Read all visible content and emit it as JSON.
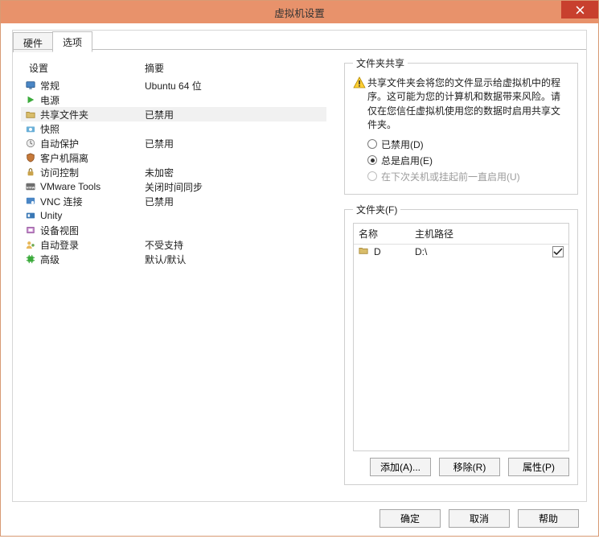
{
  "window": {
    "title": "虚拟机设置"
  },
  "tabs": {
    "hardware": "硬件",
    "options": "选项"
  },
  "left": {
    "header_setting": "设置",
    "header_summary": "摘要",
    "items": [
      {
        "name": "常规",
        "summary": "Ubuntu 64 位",
        "icon": "monitor",
        "sel": false
      },
      {
        "name": "电源",
        "summary": "",
        "icon": "play",
        "sel": false
      },
      {
        "name": "共享文件夹",
        "summary": "已禁用",
        "icon": "folder",
        "sel": true
      },
      {
        "name": "快照",
        "summary": "",
        "icon": "camera",
        "sel": false
      },
      {
        "name": "自动保护",
        "summary": "已禁用",
        "icon": "clock",
        "sel": false
      },
      {
        "name": "客户机隔离",
        "summary": "",
        "icon": "shield",
        "sel": false
      },
      {
        "name": "访问控制",
        "summary": "未加密",
        "icon": "lock",
        "sel": false
      },
      {
        "name": "VMware Tools",
        "summary": "关闭时间同步",
        "icon": "vmw",
        "sel": false
      },
      {
        "name": "VNC 连接",
        "summary": "已禁用",
        "icon": "vnc",
        "sel": false
      },
      {
        "name": "Unity",
        "summary": "",
        "icon": "unity",
        "sel": false
      },
      {
        "name": "设备视图",
        "summary": "",
        "icon": "device",
        "sel": false
      },
      {
        "name": "自动登录",
        "summary": "不受支持",
        "icon": "user",
        "sel": false
      },
      {
        "name": "高级",
        "summary": "默认/默认",
        "icon": "chip",
        "sel": false
      }
    ]
  },
  "right": {
    "share_legend": "文件夹共享",
    "warning": "共享文件夹会将您的文件显示给虚拟机中的程序。这可能为您的计算机和数据带来风险。请仅在您信任虚拟机使用您的数据时启用共享文件夹。",
    "radios": {
      "disabled": "已禁用(D)",
      "always": "总是启用(E)",
      "until": "在下次关机或挂起前一直启用(U)"
    },
    "folders_legend": "文件夹(F)",
    "folder_head_name": "名称",
    "folder_head_path": "主机路径",
    "folders": [
      {
        "name": "D",
        "path": "D:\\",
        "checked": true
      }
    ],
    "add": "添加(A)...",
    "remove": "移除(R)",
    "properties": "属性(P)"
  },
  "footer": {
    "ok": "确定",
    "cancel": "取消",
    "help": "帮助"
  }
}
